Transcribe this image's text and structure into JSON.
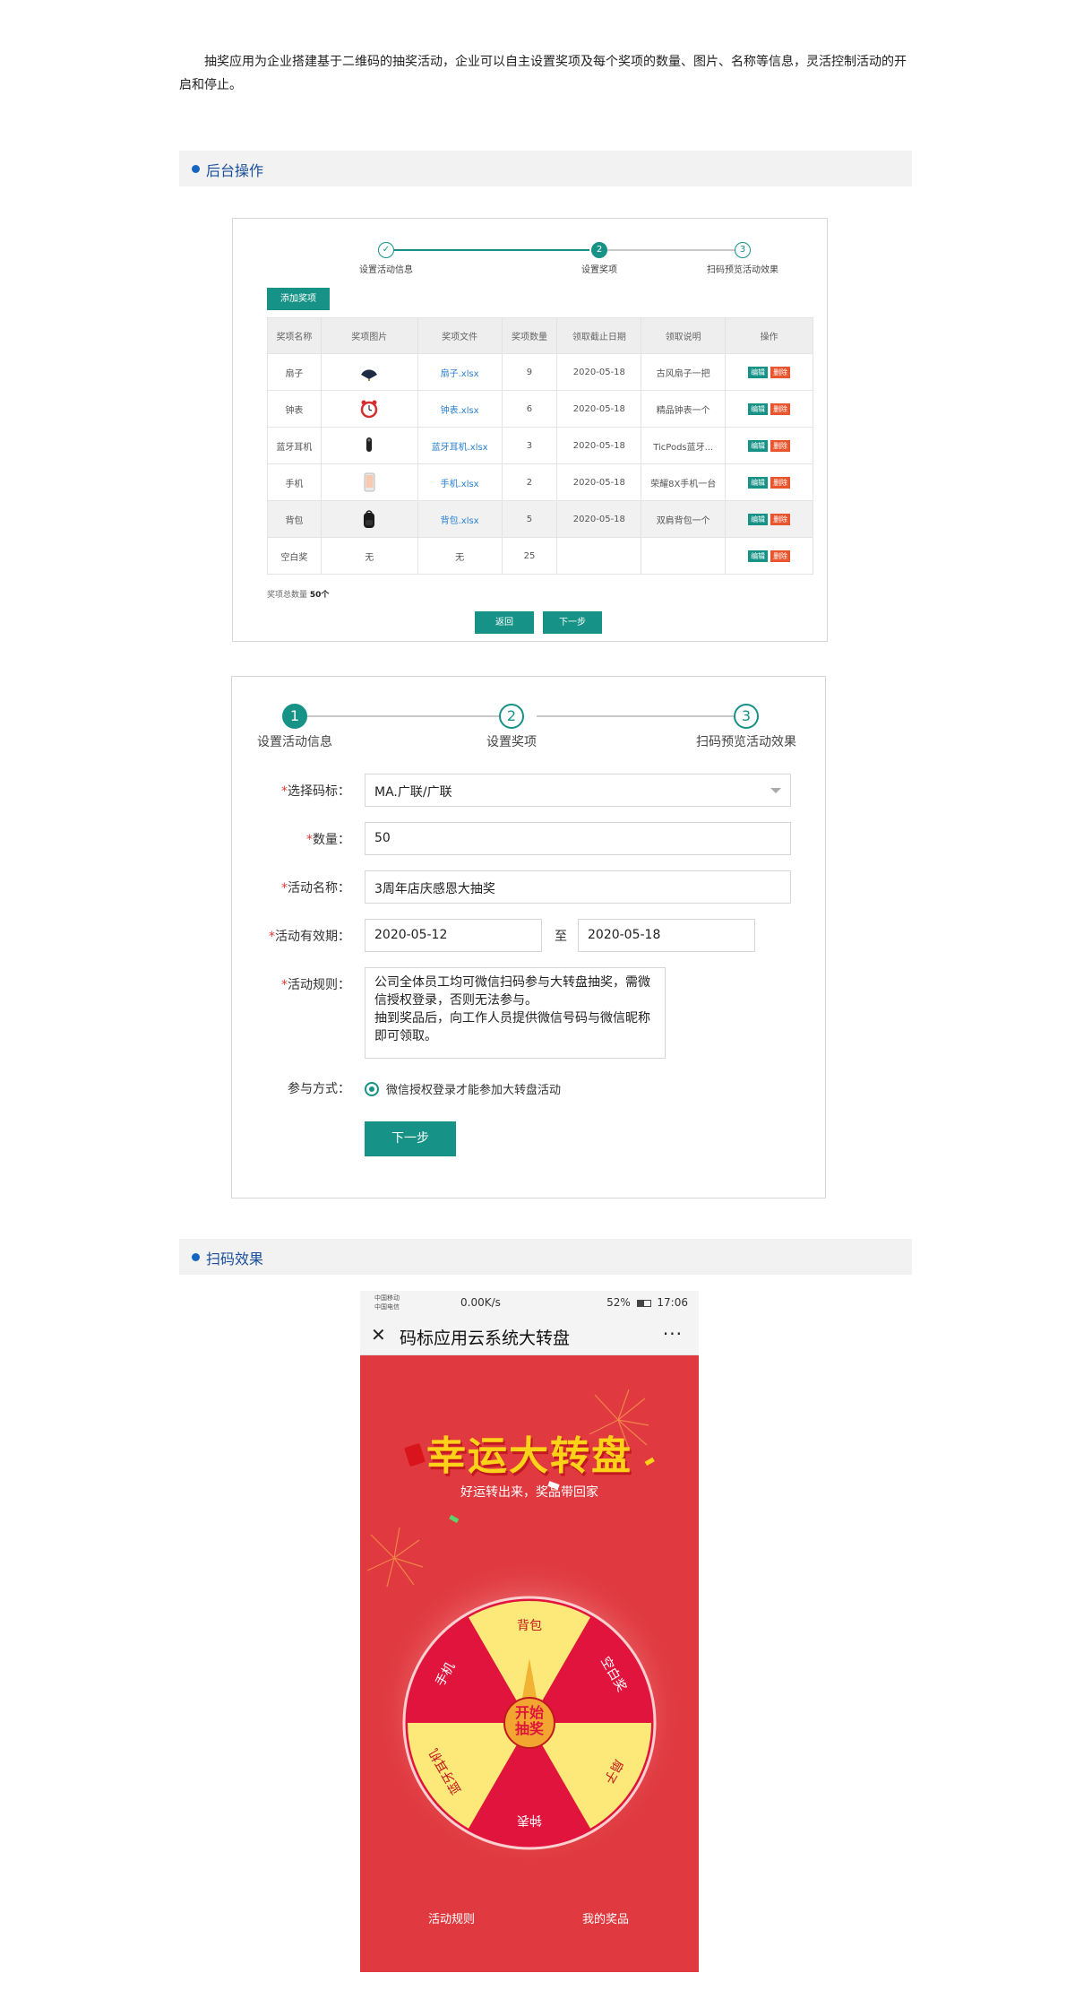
{
  "intro": "抽奖应用为企业搭建基于二维码的抽奖活动，企业可以自主设置奖项及每个奖项的数量、图片、名称等信息，灵活控制活动的开启和停止。",
  "sections": {
    "backend": "后台操作",
    "scan": "扫码效果"
  },
  "prize_panel": {
    "steps": [
      "设置活动信息",
      "设置奖项",
      "扫码预览活动效果"
    ],
    "step_numbers": [
      "✓",
      "2",
      "3"
    ],
    "add_button": "添加奖项",
    "columns": [
      "奖项名称",
      "奖项图片",
      "奖项文件",
      "奖项数量",
      "领取截止日期",
      "领取说明",
      "操作"
    ],
    "rows": [
      {
        "name": "扇子",
        "pic": "fan-icon",
        "file": "扇子.xlsx",
        "qty": "9",
        "date": "2020-05-18",
        "desc": "古风扇子一把"
      },
      {
        "name": "钟表",
        "pic": "clock-icon",
        "file": "钟表.xlsx",
        "qty": "6",
        "date": "2020-05-18",
        "desc": "精品钟表一个"
      },
      {
        "name": "蓝牙耳机",
        "pic": "earphone-icon",
        "file": "蓝牙耳机.xlsx",
        "qty": "3",
        "date": "2020-05-18",
        "desc": "TicPods蓝牙..."
      },
      {
        "name": "手机",
        "pic": "phone-icon",
        "file": "手机.xlsx",
        "qty": "2",
        "date": "2020-05-18",
        "desc": "荣耀8X手机一台"
      },
      {
        "name": "背包",
        "pic": "backpack-icon",
        "file": "背包.xlsx",
        "qty": "5",
        "date": "2020-05-18",
        "desc": "双肩背包一个"
      },
      {
        "name": "空白奖",
        "pic_text": "无",
        "file": "无",
        "qty": "25",
        "date": "",
        "desc": ""
      }
    ],
    "edit_label": "编辑",
    "delete_label": "删除",
    "total_label": "奖项总数量",
    "total_value": "50个",
    "back_button": "返回",
    "next_button": "下一步"
  },
  "info_panel": {
    "steps": [
      "设置活动信息",
      "设置奖项",
      "扫码预览活动效果"
    ],
    "step_numbers": [
      "1",
      "2",
      "3"
    ],
    "required_mark": "*",
    "fields": {
      "code_label": "选择码标：",
      "code_value": "MA.广联/广联",
      "qty_label": "数量：",
      "qty_value": "50",
      "name_label": "活动名称：",
      "name_value": "3周年店庆感恩大抽奖",
      "period_label": "活动有效期：",
      "start_date": "2020-05-12",
      "to": "至",
      "end_date": "2020-05-18",
      "rules_label": "活动规则：",
      "rules_value": "公司全体员工均可微信扫码参与大转盘抽奖，需微信授权登录，否则无法参与。\n抽到奖品后，向工作人员提供微信号码与微信昵称即可领取。",
      "mode_label": "参与方式：",
      "mode_value": "微信授权登录才能参加大转盘活动"
    },
    "next_button": "下一步"
  },
  "phone": {
    "carrier1": "中国移动",
    "carrier2": "中国电信",
    "speed": "0.00K/s",
    "battery": "52%",
    "time": "17:06",
    "nav_title": "码标应用云系统大转盘",
    "more": "···",
    "game_title": "幸运大转盘",
    "game_sub": "好运转出来，奖品带回家",
    "wheel_center": [
      "开始",
      "抽奖"
    ],
    "wheel_prizes": [
      "背包",
      "空白奖",
      "扇子",
      "钟表",
      "蓝牙耳机",
      "手机"
    ],
    "rules_link": "活动规则",
    "prize_link": "我的奖品"
  },
  "colors": {
    "accent": "#169286",
    "danger": "#e9552e",
    "section_title": "#1a4f9c",
    "wheel_red": "#e0143c",
    "wheel_yellow": "#fde979"
  }
}
